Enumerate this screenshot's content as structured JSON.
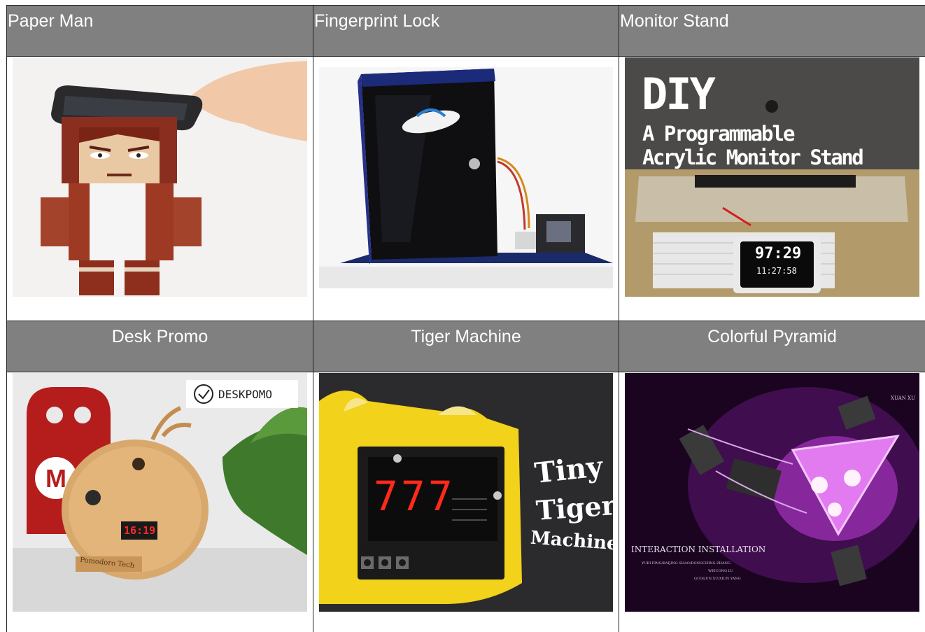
{
  "table": {
    "row1": [
      {
        "title": "Paper Man",
        "image": "paper-man-photo"
      },
      {
        "title": "Fingerprint Lock",
        "image": "fingerprint-lock-photo"
      },
      {
        "title": "Monitor Stand",
        "image": "monitor-stand-photo"
      }
    ],
    "row2": [
      {
        "title": "Desk Promo",
        "image": "desk-promo-photo"
      },
      {
        "title": "Tiger Machine",
        "image": "tiger-machine-photo"
      },
      {
        "title": "Colorful Pyramid",
        "image": "colorful-pyramid-photo"
      }
    ]
  },
  "photo_text": {
    "monitor": {
      "line1": "DIY",
      "line2": "A Programmable",
      "line3": "Acrylic Monitor Stand",
      "time1": "97:29",
      "time2": "11:27:58"
    },
    "deskpomo": {
      "brand": "DESKPOMO",
      "clock": "16:19",
      "badge": "Pomodoro Tech"
    },
    "tiger": {
      "line1": "Tiny",
      "line2": "Tiger",
      "line3": "Machine",
      "digits": "777"
    },
    "pyramid": {
      "corner": "XUAN XU",
      "title": "INTERACTION INSTALLATION",
      "credits1": "YUBI PING/BAIJING SHAO/DONGCHING ZHANG",
      "credits2": "WEICONG LU",
      "credits3": "GUOQUN XU/XIUN YANG"
    }
  },
  "colors": {
    "header_bg": "#808080",
    "header_text": "#ffffff",
    "border": "#222222"
  }
}
